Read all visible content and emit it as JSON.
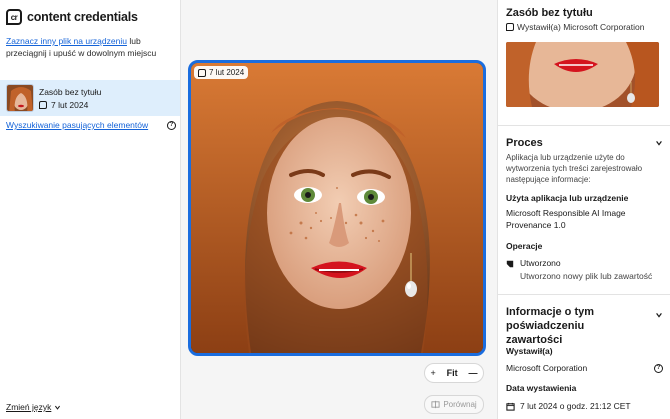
{
  "brand": {
    "logo_mark": "cr",
    "name": "content credentials"
  },
  "sidebar": {
    "upload_link": "Zaznacz inny plik na urządzeniu",
    "upload_rest": " lub przeciągnij i upuść w dowolnym miejscu",
    "asset": {
      "name": "Zasób bez tytułu",
      "date": "7 lut 2024"
    },
    "match_search": "Wyszukiwanie pasujących elementów",
    "language": "Zmień język"
  },
  "viewer": {
    "badge_date": "7 lut 2024",
    "zoom_in": "+",
    "zoom_fit": "Fit",
    "zoom_out": "—",
    "compare": "Porównaj"
  },
  "panel": {
    "title": "Zasób bez tytułu",
    "issuer": "Wystawił(a) Microsoft Corporation",
    "process": {
      "heading": "Proces",
      "desc": "Aplikacja lub urządzenie użyte do wytworzenia tych treści zarejestrowało następujące informacje:",
      "app_label": "Użyta aplikacja lub urządzenie",
      "app_value": "Microsoft Responsible AI Image Provenance 1.0",
      "ops_label": "Operacje",
      "op_name": "Utworzono",
      "op_desc": "Utworzono nowy plik lub zawartość"
    },
    "info": {
      "heading": "Informacje o tym poświadczeniu zawartości",
      "issuer_label": "Wystawił(a)",
      "issuer_value": "Microsoft Corporation",
      "date_label": "Data wystawienia",
      "date_value": "7 lut 2024 o godz. 21:12 CET"
    }
  },
  "colors": {
    "accent": "#1a6ddf",
    "link": "#1463d8",
    "selected": "#deeefc"
  }
}
